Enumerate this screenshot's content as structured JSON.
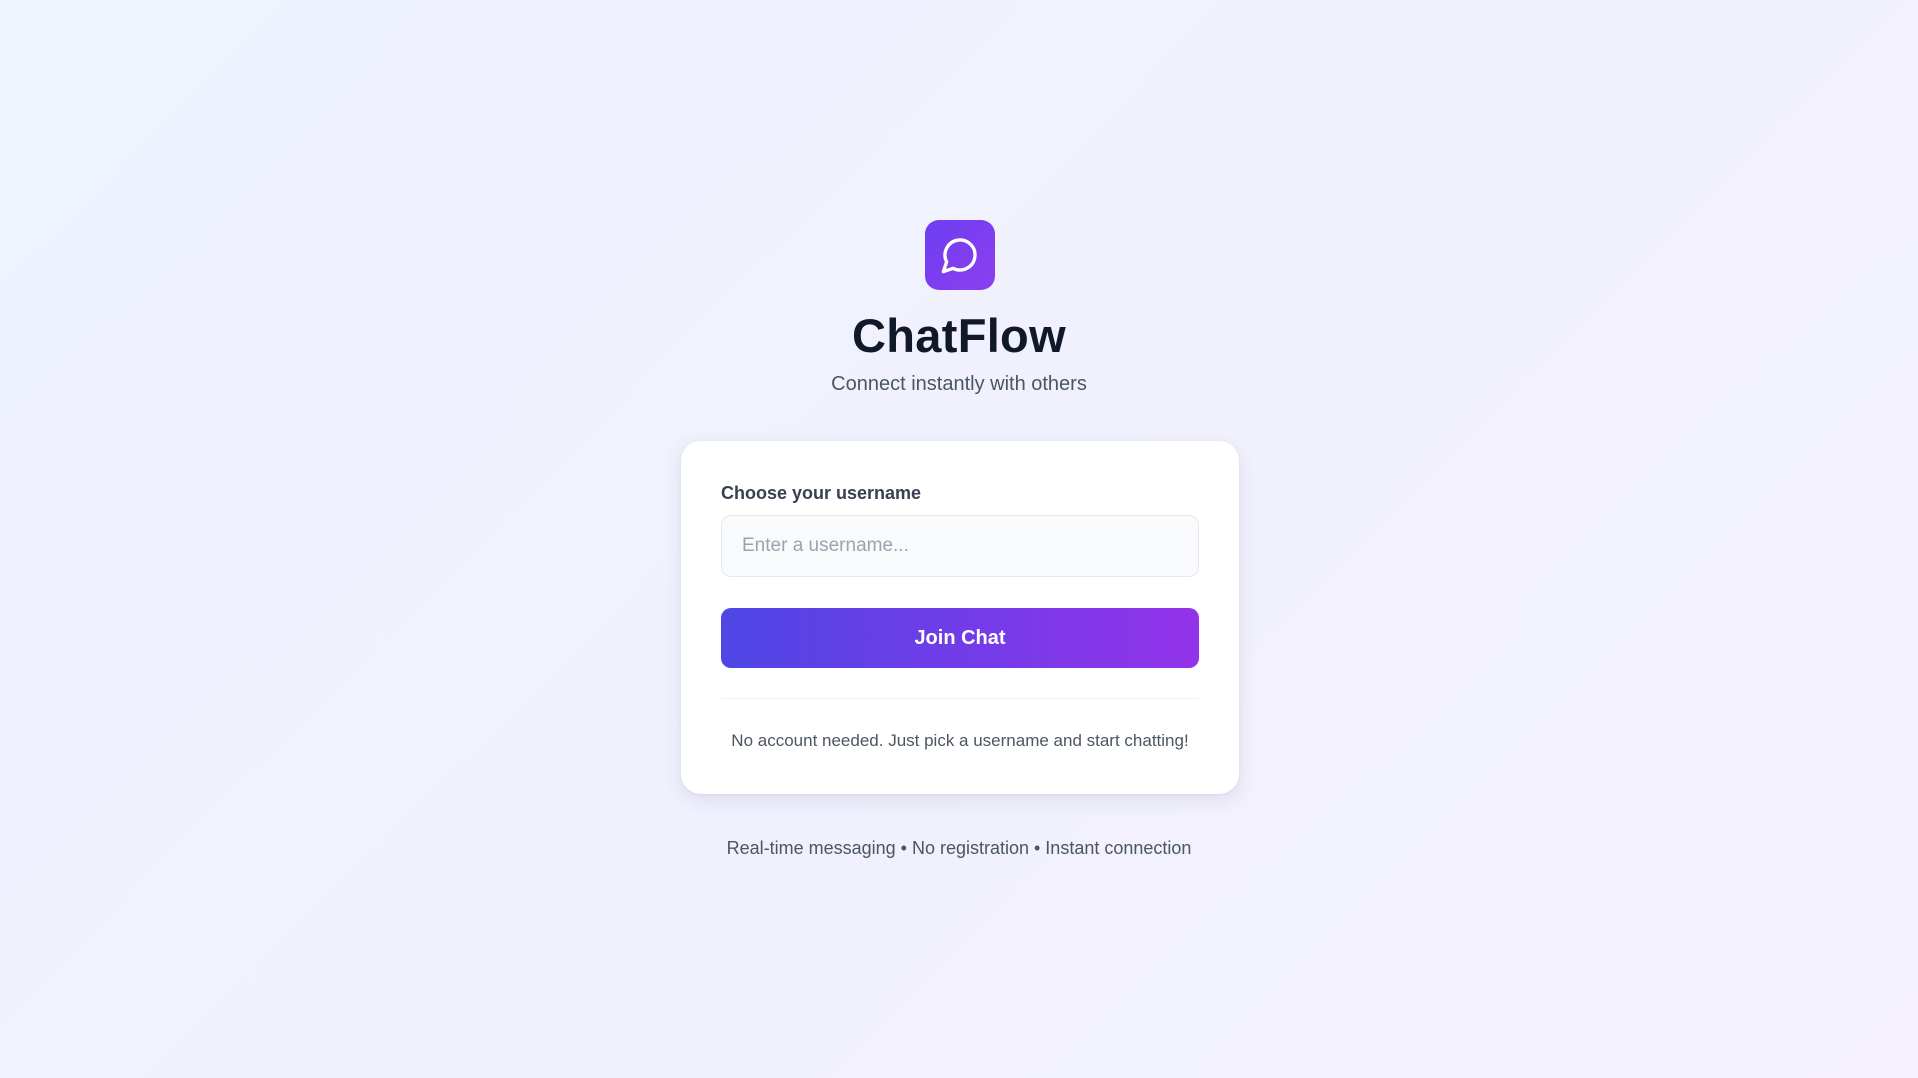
{
  "app": {
    "name": "ChatFlow",
    "tagline": "Connect instantly with others",
    "logo_icon": "chat-bubble-icon",
    "brand_gradient": [
      "#6d3ef0",
      "#8b3ff0"
    ]
  },
  "login_card": {
    "field_label": "Choose your username",
    "username_input": {
      "value": "",
      "placeholder": "Enter a username..."
    },
    "join_button_label": "Join Chat",
    "join_button_gradient": [
      "#4f46e5",
      "#9333ea"
    ],
    "note": "No account needed. Just pick a username and start chatting!"
  },
  "footer": {
    "features": "Real-time messaging • No registration • Instant connection"
  }
}
